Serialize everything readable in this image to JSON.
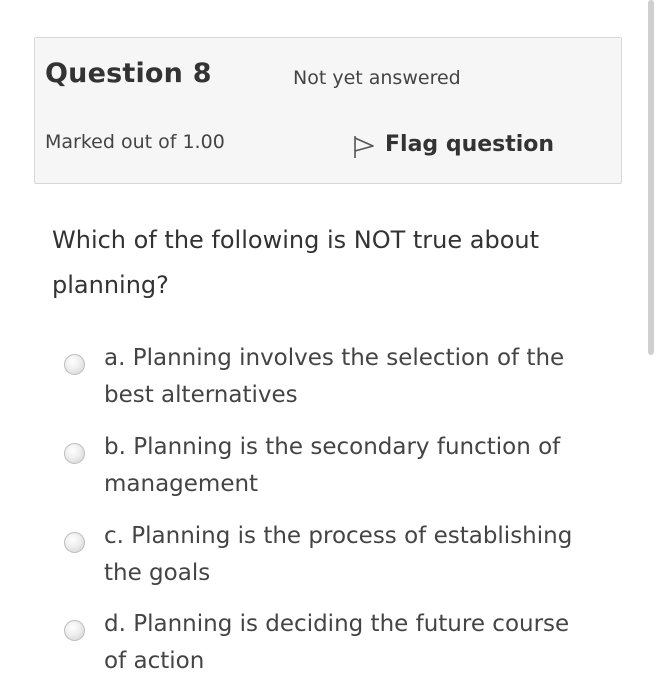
{
  "info": {
    "question_number": "Question 8",
    "state": "Not yet answered",
    "grade": "Marked out of 1.00",
    "flag_label": "Flag question"
  },
  "question": {
    "text": "Which of the following is NOT true about planning?"
  },
  "answers": [
    {
      "label": "a. Planning involves the selection of the best alternatives",
      "selected": false
    },
    {
      "label": "b. Planning is the secondary function of management",
      "selected": false
    },
    {
      "label": "c. Planning is the process of establishing the goals",
      "selected": false
    },
    {
      "label": "d. Planning is deciding the future course of action",
      "selected": false
    }
  ],
  "icons": {
    "flag": "flag-icon",
    "radio": "radio-unchecked-icon"
  }
}
